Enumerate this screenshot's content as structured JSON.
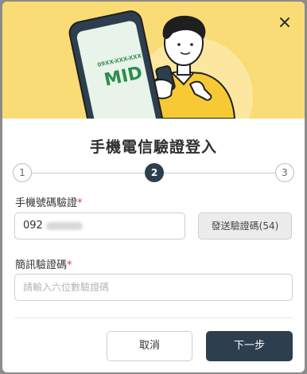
{
  "dialog": {
    "title": "手機電信驗證登入",
    "close_icon": "close-icon"
  },
  "illustration": {
    "phone_number_text": "09XX-XXX-XXX",
    "brand_text": "MID"
  },
  "stepper": {
    "steps": [
      {
        "label": "1",
        "state": "done"
      },
      {
        "label": "2",
        "state": "active"
      },
      {
        "label": "3",
        "state": "pending"
      }
    ]
  },
  "phone_field": {
    "label": "手機號碼驗證",
    "required_mark": "*",
    "value_prefix": "092"
  },
  "send_button": {
    "label": "發送驗證碼(54)"
  },
  "code_field": {
    "label": "簡訊驗證碼",
    "required_mark": "*",
    "placeholder": "請輸入六位數驗證碼"
  },
  "footer": {
    "cancel_label": "取消",
    "next_label": "下一步"
  },
  "colors": {
    "hero_bg": "#f9dc75",
    "primary": "#2d3f4f",
    "required": "#e53935"
  }
}
